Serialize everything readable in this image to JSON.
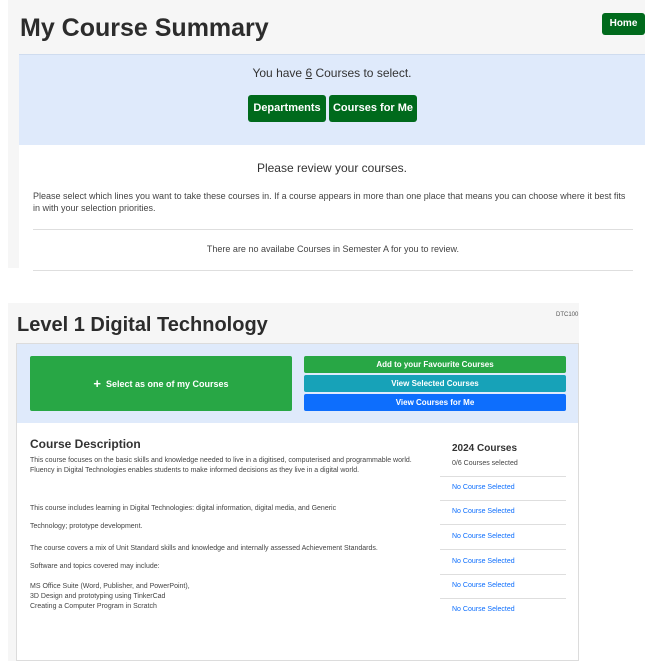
{
  "header": {
    "title": "My Course Summary",
    "home_label": "Home"
  },
  "summary": {
    "have_prefix": "You have ",
    "have_count": "6",
    "have_suffix": " Courses to select.",
    "departments_label": "Departments",
    "courses_for_me_label": "Courses for Me",
    "review_title": "Please review your courses.",
    "review_text": "Please select which lines you want to take these courses in. If a course appears in more than one place that means you can choose where it best fits in with your selection priorities.",
    "no_courses_text": "There are no availabe Courses in Semester A for you to review."
  },
  "course": {
    "title": "Level 1 Digital Technology",
    "code": "DTC100",
    "select_label": "Select as one of my Courses",
    "favourite_label": "Add to your Favourite Courses",
    "view_selected_label": "View Selected Courses",
    "view_for_me_label": "View Courses for Me",
    "description_heading": "Course Description",
    "paragraphs": [
      "This course focuses on the basic skills and knowledge needed to live in a digitised, computerised and programmable world. Fluency in Digital Technologies enables students to make informed decisions as they live in a digital world.",
      "This course includes learning in Digital Technologies: digital information, digital media, and Generic",
      "Technology; prototype development.",
      "The course covers a mix of Unit Standard skills and knowledge and internally assessed Achievement Standards.",
      "Software and topics covered may include:",
      "MS Office Suite (Word, Publisher, and PowerPoint),\n3D Design and prototyping using TinkerCad\nCreating a Computer Program in Scratch"
    ],
    "courses_year_heading": "2024 Courses",
    "courses_selected": "0/6 Courses selected",
    "selections": [
      "No Course Selected",
      "No Course Selected",
      "No Course Selected",
      "No Course Selected",
      "No Course Selected",
      "No Course Selected"
    ]
  }
}
